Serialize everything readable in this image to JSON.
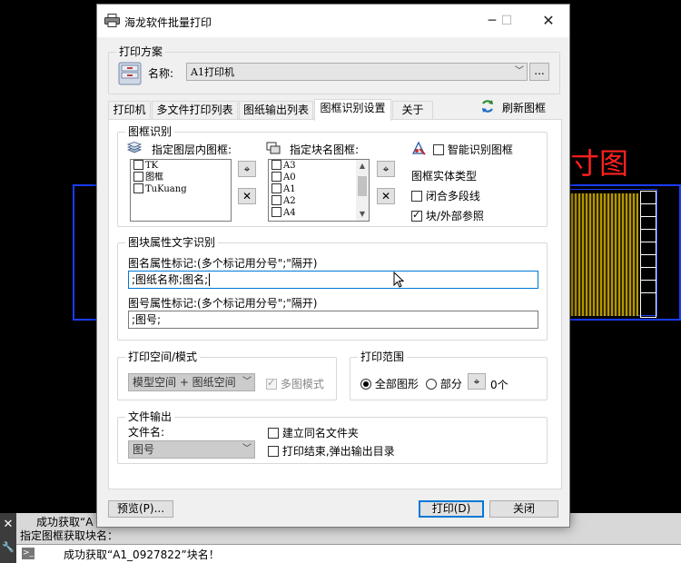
{
  "cad": {
    "red_text": "寸图"
  },
  "command": {
    "line1": "成功获取“A",
    "line2": "指定图框获取块名：",
    "line3": "成功获取“A1_0927822”块名！"
  },
  "dialog": {
    "title": "海龙软件批量打印",
    "scheme": {
      "group_label": "打印方案",
      "name_label": "名称:",
      "name_value": "A1打印机",
      "browse_label": "..."
    },
    "tabs": [
      {
        "label": "打印机"
      },
      {
        "label": "多文件打印列表"
      },
      {
        "label": "图纸输出列表"
      },
      {
        "label": "图框识别设置"
      },
      {
        "label": "关于"
      }
    ],
    "refresh_label": "刷新图框",
    "frame_recognition": {
      "group_label": "图框识别",
      "layer_label": "指定图层内图框:",
      "layer_items": [
        "TK",
        "图框",
        "TuKuang"
      ],
      "block_label": "指定块名图框:",
      "block_items": [
        "A3",
        "A0",
        "A1",
        "A2",
        "A4"
      ],
      "smart_label": "智能识别图框",
      "entity_type_label": "图框实体类型",
      "polyline_label": "闭合多段线",
      "block_ref_label": "块/外部参照"
    },
    "attr_text": {
      "group_label": "图块属性文字识别",
      "name_attr_label": "图名属性标记:(多个标记用分号\";\"隔开)",
      "name_attr_value": ";图纸名称;图名;",
      "num_attr_label": "图号属性标记:(多个标记用分号\";\"隔开)",
      "num_attr_value": ";图号;"
    },
    "print_space": {
      "group_label": "打印空间/模式",
      "mode_value": "模型空间 + 图纸空间",
      "multi_label": "多图模式"
    },
    "print_range": {
      "group_label": "打印范围",
      "all_label": "全部图形",
      "part_label": "部分",
      "count": "0个"
    },
    "file_output": {
      "group_label": "文件输出",
      "filename_label": "文件名:",
      "filename_value": "图号",
      "same_folder_label": "建立同名文件夹",
      "popup_label": "打印结束,弹出输出目录"
    },
    "buttons": {
      "preview": "预览(P)...",
      "print": "打印(D)",
      "close": "关闭"
    }
  }
}
